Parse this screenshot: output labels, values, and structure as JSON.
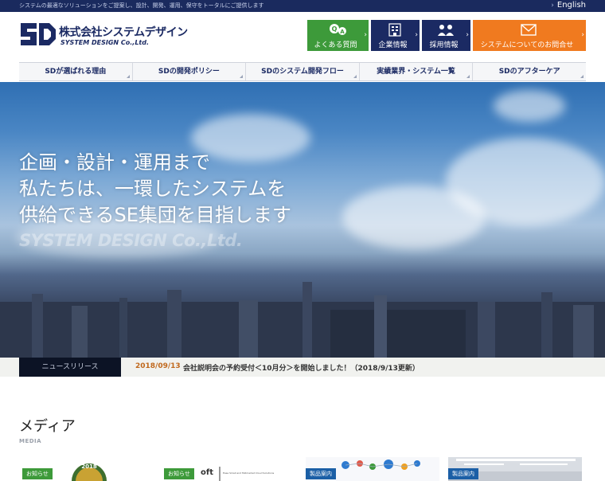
{
  "topbar": {
    "tagline": "システムの最適なソリューションをご提案し、設計、開発、運用、保守をトータルにご提供します",
    "language_label": "English"
  },
  "logo": {
    "name_jp": "株式会社システムデザイン",
    "name_en": "SYSTEM DESIGN Co.,Ltd."
  },
  "header_buttons": [
    {
      "label": "よくある質問",
      "icon": "faq-chat-icon",
      "color": "#3d9a3a"
    },
    {
      "label": "企業情報",
      "icon": "building-icon",
      "color": "#1b2a63"
    },
    {
      "label": "採用情報",
      "icon": "people-icon",
      "color": "#1b2a63"
    },
    {
      "label": "システムについてのお問合せ",
      "icon": "mail-icon",
      "color": "#f07a1f"
    }
  ],
  "global_nav": [
    {
      "label": "SDが選ばれる理由"
    },
    {
      "label": "SDの開発ポリシー"
    },
    {
      "label": "SDのシステム開発フロー"
    },
    {
      "label": "実績業界・システム一覧"
    },
    {
      "label": "SDのアフターケア"
    }
  ],
  "hero": {
    "line1": "企画・設計・運用まで",
    "line2": "私たちは、一環したシステムを",
    "line3": "供給できるSE集団を目指します",
    "watermark": "SYSTEM DESIGN Co.,Ltd."
  },
  "news": {
    "tab_label": "ニュースリリース",
    "date": "2018/09/13",
    "title": "会社説明会の予約受付＜10月分＞を開始しました！（2018/9/13更新）"
  },
  "media": {
    "title": "メディア",
    "subtitle": "MEDIA",
    "cards": [
      {
        "tag": "お知らせ",
        "tag_color": "#3d9a3a",
        "thumb_text": "2018"
      },
      {
        "tag": "お知らせ",
        "tag_color": "#3d9a3a",
        "thumb_text": "oft",
        "thumb_caption": "Ease Small and Midmarket Cloud Solutions"
      },
      {
        "tag": "製品案内",
        "tag_color": "#1b5fa6"
      },
      {
        "tag": "製品案内",
        "tag_color": "#1b5fa6"
      }
    ]
  },
  "colors": {
    "brand_navy": "#1b2a63",
    "accent_green": "#3d9a3a",
    "accent_orange": "#f07a1f",
    "news_date": "#c0681c"
  }
}
